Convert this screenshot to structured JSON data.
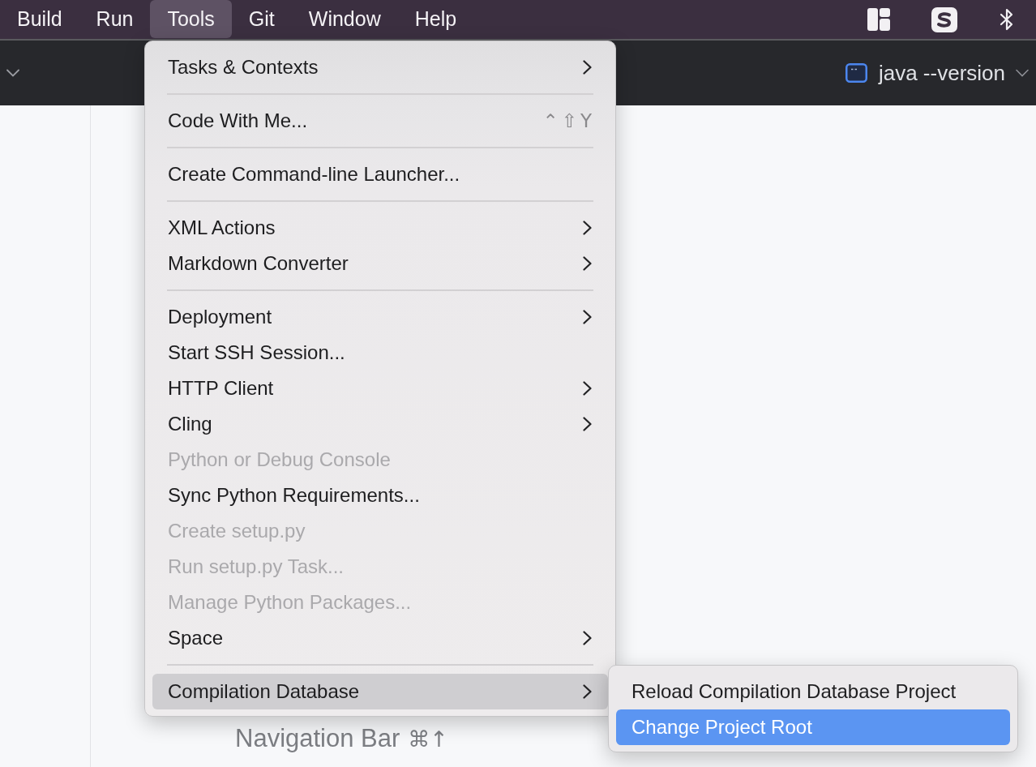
{
  "menu_bar": {
    "items": [
      {
        "label": "Build",
        "selected": false
      },
      {
        "label": "Run",
        "selected": false
      },
      {
        "label": "Tools",
        "selected": true
      },
      {
        "label": "Git",
        "selected": false
      },
      {
        "label": "Window",
        "selected": false
      },
      {
        "label": "Help",
        "selected": false
      }
    ]
  },
  "toolbar": {
    "run_configuration": "java --version"
  },
  "tools_menu": {
    "items": [
      {
        "kind": "item",
        "label": "Tasks & Contexts",
        "submenu": true,
        "disabled": false,
        "selected": false
      },
      {
        "kind": "separator"
      },
      {
        "kind": "item",
        "label": "Code With Me...",
        "shortcut": "⌃⇧Y",
        "submenu": false,
        "disabled": false,
        "selected": false
      },
      {
        "kind": "separator"
      },
      {
        "kind": "item",
        "label": "Create Command-line Launcher...",
        "submenu": false,
        "disabled": false,
        "selected": false
      },
      {
        "kind": "separator"
      },
      {
        "kind": "item",
        "label": "XML Actions",
        "submenu": true,
        "disabled": false,
        "selected": false
      },
      {
        "kind": "item",
        "label": "Markdown Converter",
        "submenu": true,
        "disabled": false,
        "selected": false
      },
      {
        "kind": "separator"
      },
      {
        "kind": "item",
        "label": "Deployment",
        "submenu": true,
        "disabled": false,
        "selected": false
      },
      {
        "kind": "item",
        "label": "Start SSH Session...",
        "submenu": false,
        "disabled": false,
        "selected": false
      },
      {
        "kind": "item",
        "label": "HTTP Client",
        "submenu": true,
        "disabled": false,
        "selected": false
      },
      {
        "kind": "item",
        "label": "Cling",
        "submenu": true,
        "disabled": false,
        "selected": false
      },
      {
        "kind": "item",
        "label": "Python or Debug Console",
        "submenu": false,
        "disabled": true,
        "selected": false
      },
      {
        "kind": "item",
        "label": "Sync Python Requirements...",
        "submenu": false,
        "disabled": false,
        "selected": false
      },
      {
        "kind": "item",
        "label": "Create setup.py",
        "submenu": false,
        "disabled": true,
        "selected": false
      },
      {
        "kind": "item",
        "label": "Run setup.py Task...",
        "submenu": false,
        "disabled": true,
        "selected": false
      },
      {
        "kind": "item",
        "label": "Manage Python Packages...",
        "submenu": false,
        "disabled": true,
        "selected": false
      },
      {
        "kind": "item",
        "label": "Space",
        "submenu": true,
        "disabled": false,
        "selected": false
      },
      {
        "kind": "separator"
      },
      {
        "kind": "item",
        "label": "Compilation Database",
        "submenu": true,
        "disabled": false,
        "selected": true
      }
    ]
  },
  "compilation_submenu": {
    "items": [
      {
        "label": "Reload Compilation Database Project",
        "selected": false
      },
      {
        "label": "Change Project Root",
        "selected": true
      }
    ]
  },
  "editor": {
    "hint": "Navigation Bar",
    "shortcut": "⌘↑"
  }
}
